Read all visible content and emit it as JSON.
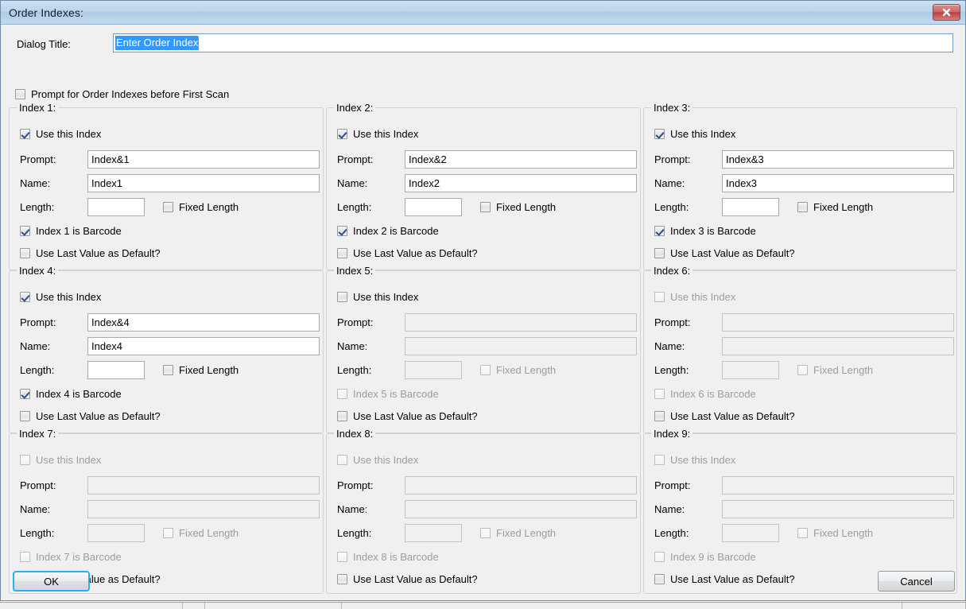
{
  "window": {
    "title": "Order Indexes:",
    "close_icon": "close-icon"
  },
  "form": {
    "dialog_title_label": "Dialog Title:",
    "dialog_title_value": "Enter Order Index",
    "prompt_first_scan_label": "Prompt for Order Indexes before First Scan",
    "prompt_first_scan_checked": false
  },
  "labels": {
    "use_this_index": "Use this Index",
    "prompt": "Prompt:",
    "name": "Name:",
    "length": "Length:",
    "fixed_length": "Fixed Length",
    "use_last_value": "Use Last Value as Default?"
  },
  "groups": [
    {
      "title": "Index 1:",
      "use_checked": true,
      "use_disabled": false,
      "prompt_value": "Index&1",
      "name_value": "Index1",
      "length_value": "",
      "fields_disabled": false,
      "fixed_checked": false,
      "fixed_disabled": false,
      "barcode_label": "Index 1 is Barcode",
      "barcode_checked": true,
      "barcode_disabled": false,
      "last_checked": false,
      "last_disabled": false
    },
    {
      "title": "Index 2:",
      "use_checked": true,
      "use_disabled": false,
      "prompt_value": "Index&2",
      "name_value": "Index2",
      "length_value": "",
      "fields_disabled": false,
      "fixed_checked": false,
      "fixed_disabled": false,
      "barcode_label": "Index 2 is Barcode",
      "barcode_checked": true,
      "barcode_disabled": false,
      "last_checked": false,
      "last_disabled": false
    },
    {
      "title": "Index 3:",
      "use_checked": true,
      "use_disabled": false,
      "prompt_value": "Index&3",
      "name_value": "Index3",
      "length_value": "",
      "fields_disabled": false,
      "fixed_checked": false,
      "fixed_disabled": false,
      "barcode_label": "Index 3 is Barcode",
      "barcode_checked": true,
      "barcode_disabled": false,
      "last_checked": false,
      "last_disabled": false
    },
    {
      "title": "Index 4:",
      "use_checked": true,
      "use_disabled": false,
      "prompt_value": "Index&4",
      "name_value": "Index4",
      "length_value": "",
      "fields_disabled": false,
      "fixed_checked": false,
      "fixed_disabled": false,
      "barcode_label": "Index 4 is Barcode",
      "barcode_checked": true,
      "barcode_disabled": false,
      "last_checked": false,
      "last_disabled": false
    },
    {
      "title": "Index 5:",
      "use_checked": false,
      "use_disabled": false,
      "prompt_value": "",
      "name_value": "",
      "length_value": "",
      "fields_disabled": true,
      "fixed_checked": false,
      "fixed_disabled": true,
      "barcode_label": "Index 5 is Barcode",
      "barcode_checked": false,
      "barcode_disabled": true,
      "last_checked": false,
      "last_disabled": false
    },
    {
      "title": "Index 6:",
      "use_checked": false,
      "use_disabled": true,
      "prompt_value": "",
      "name_value": "",
      "length_value": "",
      "fields_disabled": true,
      "fixed_checked": false,
      "fixed_disabled": true,
      "barcode_label": "Index 6 is Barcode",
      "barcode_checked": false,
      "barcode_disabled": true,
      "last_checked": false,
      "last_disabled": false
    },
    {
      "title": "Index 7:",
      "use_checked": false,
      "use_disabled": true,
      "prompt_value": "",
      "name_value": "",
      "length_value": "",
      "fields_disabled": true,
      "fixed_checked": false,
      "fixed_disabled": true,
      "barcode_label": "Index 7 is Barcode",
      "barcode_checked": false,
      "barcode_disabled": true,
      "last_checked": false,
      "last_disabled": false
    },
    {
      "title": "Index 8:",
      "use_checked": false,
      "use_disabled": true,
      "prompt_value": "",
      "name_value": "",
      "length_value": "",
      "fields_disabled": true,
      "fixed_checked": false,
      "fixed_disabled": true,
      "barcode_label": "Index 8 is Barcode",
      "barcode_checked": false,
      "barcode_disabled": true,
      "last_checked": false,
      "last_disabled": false
    },
    {
      "title": "Index 9:",
      "use_checked": false,
      "use_disabled": true,
      "prompt_value": "",
      "name_value": "",
      "length_value": "",
      "fields_disabled": true,
      "fixed_checked": false,
      "fixed_disabled": true,
      "barcode_label": "Index 9 is Barcode",
      "barcode_checked": false,
      "barcode_disabled": true,
      "last_checked": false,
      "last_disabled": false
    }
  ],
  "footer": {
    "ok_label": "OK",
    "cancel_label": "Cancel"
  },
  "colors": {
    "titlebar": "#bcd4ea",
    "selection": "#3399ff",
    "focus_ring": "#2ab0ee",
    "close_button": "#b94141",
    "disabled_text": "#9d9d9d"
  }
}
